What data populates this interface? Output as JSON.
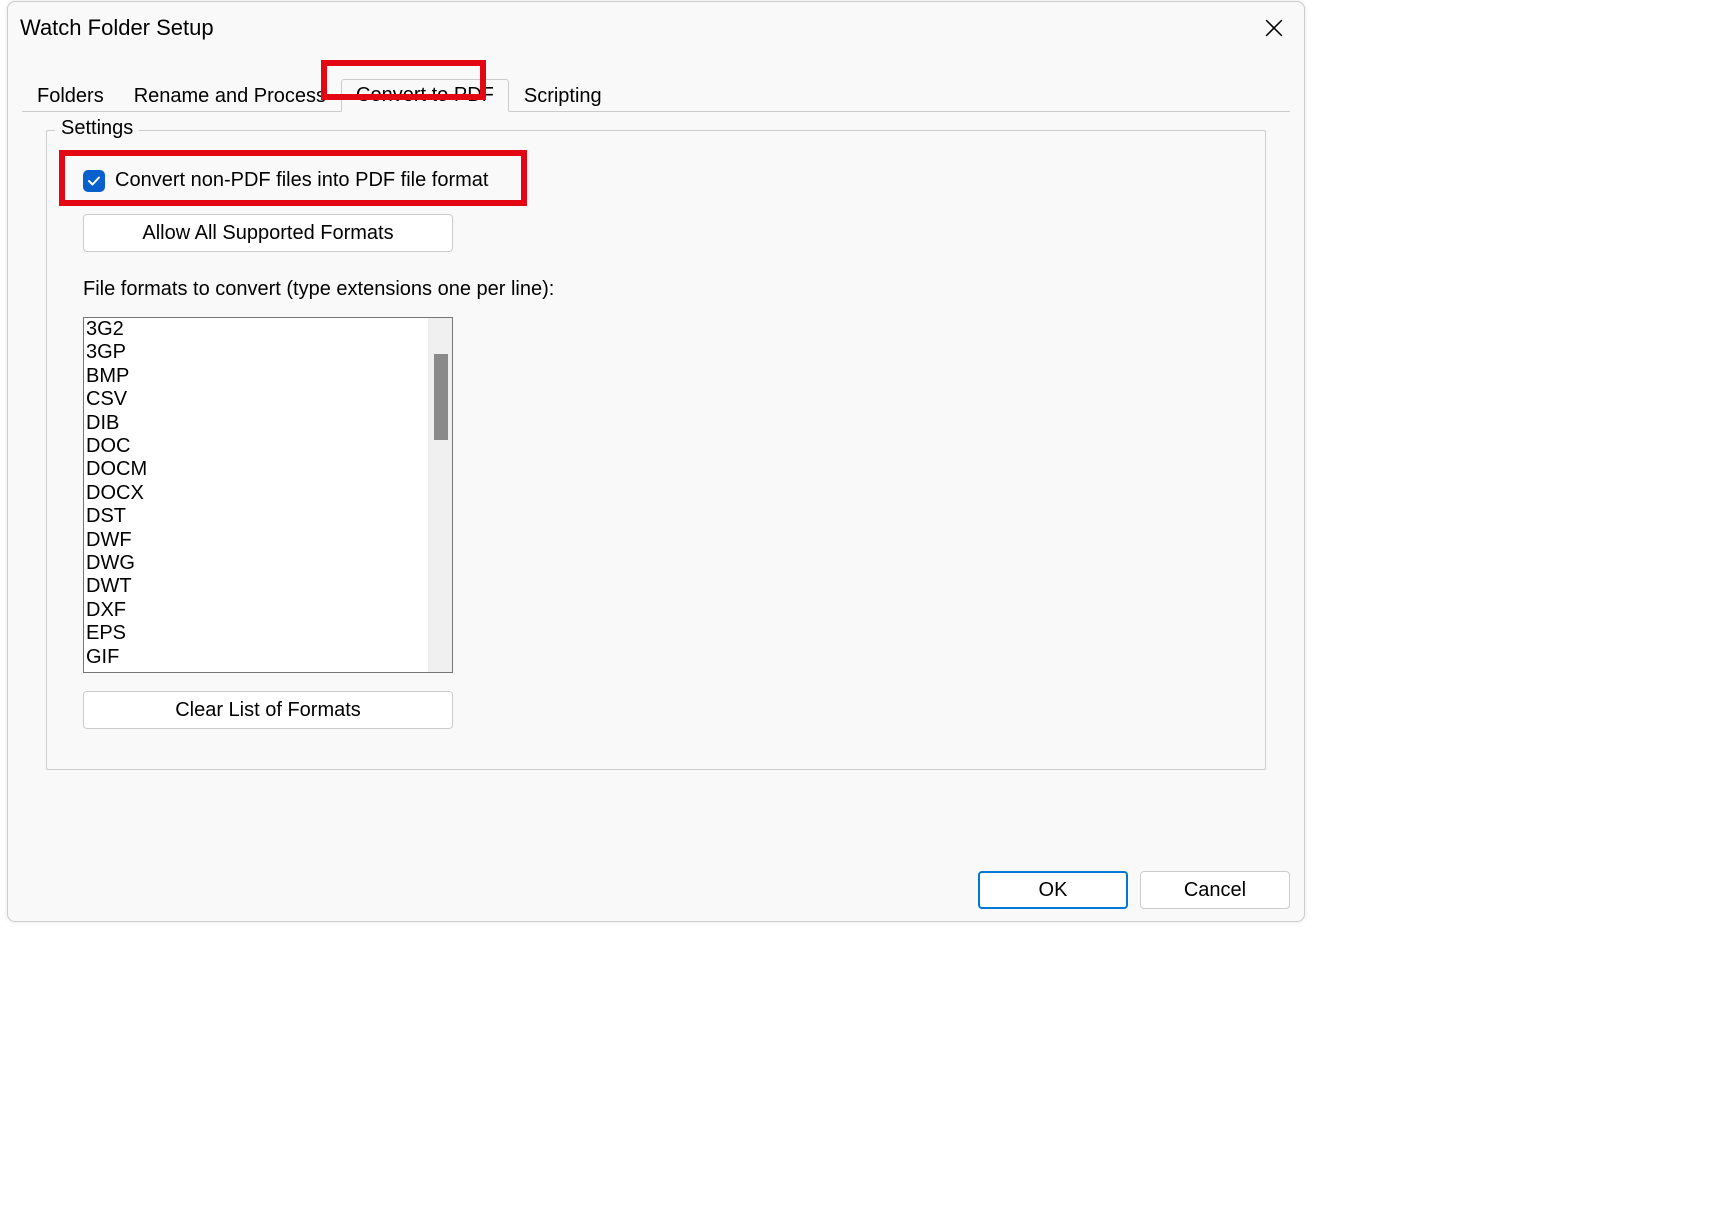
{
  "dialog": {
    "title": "Watch Folder Setup"
  },
  "tabs": {
    "folders": "Folders",
    "rename": "Rename and Process",
    "convert": "Convert to PDF",
    "scripting": "Scripting"
  },
  "settings": {
    "legend": "Settings",
    "convert_checkbox_label": "Convert non-PDF files into PDF file format",
    "convert_checkbox_checked": true,
    "allow_all_button": "Allow All Supported Formats",
    "formats_label": "File formats to convert (type extensions one per line):",
    "formats_list": [
      "3G2",
      "3GP",
      "BMP",
      "CSV",
      "DIB",
      "DOC",
      "DOCM",
      "DOCX",
      "DST",
      "DWF",
      "DWG",
      "DWT",
      "DXF",
      "EPS",
      "GIF"
    ],
    "clear_button": "Clear List of Formats"
  },
  "buttons": {
    "ok": "OK",
    "cancel": "Cancel"
  }
}
